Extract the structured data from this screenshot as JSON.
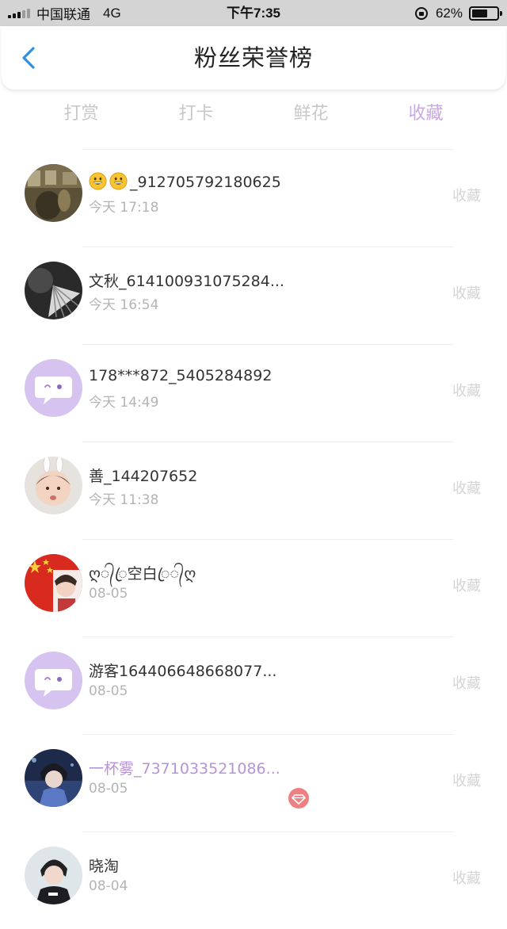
{
  "status_bar": {
    "carrier": "中国联通",
    "network": "4G",
    "time": "下午7:35",
    "battery_percent": "62%",
    "battery_level": 0.62
  },
  "header": {
    "title": "粉丝荣誉榜",
    "back_icon": "chevron-left-icon"
  },
  "tabs": [
    {
      "label": "打赏",
      "active": false
    },
    {
      "label": "打卡",
      "active": false
    },
    {
      "label": "鲜花",
      "active": false
    },
    {
      "label": "收藏",
      "active": true
    }
  ],
  "colors": {
    "accent": "#c9a8e4",
    "tab_inactive": "#c8c8c8",
    "vip_name": "#b693d8",
    "vip_badge": "#ee7f82",
    "default_avatar": "#d6c3f0"
  },
  "fans": [
    {
      "name": "_912705792180625",
      "prefix_emoji": [
        "grinning-face",
        "grinning-face"
      ],
      "time": "今天 17:18",
      "action": "收藏"
    },
    {
      "name": "文秋_614100931075284...",
      "time": "今天 16:54",
      "action": "收藏"
    },
    {
      "name": "178***872_5405284892",
      "time": "今天 14:49",
      "action": "收藏",
      "default_avatar": true
    },
    {
      "name": "善_144207652",
      "time": "今天 11:38",
      "action": "收藏"
    },
    {
      "name": "ღ᭄ꦿ空白ꦿ᭄ღ",
      "time": "08-05",
      "action": "收藏"
    },
    {
      "name": "游客164406648668077...",
      "time": "08-05",
      "action": "收藏",
      "default_avatar": true
    },
    {
      "name": "一杯雾_7371033521086...",
      "time": "08-05",
      "action": "收藏",
      "vip": true
    },
    {
      "name": "晓淘",
      "time": "08-04",
      "action": "收藏"
    }
  ]
}
